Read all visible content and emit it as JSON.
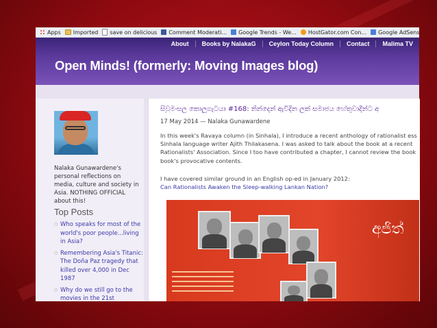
{
  "bookmarks": [
    {
      "label": "Apps",
      "icon": "apps-icon"
    },
    {
      "label": "Imported",
      "icon": "folder-icon"
    },
    {
      "label": "save on delicious",
      "icon": "page-icon"
    },
    {
      "label": "Comment Moderati...",
      "icon": "facebook-icon"
    },
    {
      "label": "Google Trends - We...",
      "icon": "google-icon"
    },
    {
      "label": "HostGator.com Con...",
      "icon": "hostgator-icon"
    },
    {
      "label": "Google AdSense",
      "icon": "google-icon"
    }
  ],
  "nav": [
    "About",
    "Books by NalakaG",
    "Ceylon Today Column",
    "Contact",
    "Malima TV"
  ],
  "site": {
    "title": "Open Minds! (formerly: Moving Images blog)"
  },
  "sidebar": {
    "bio": "Nalaka Gunawardene's personal reflections on media, culture and society in Asia. NOTHING OFFICIAL about this!",
    "top_posts_heading": "Top Posts",
    "posts": [
      "Who speaks for most of the world's poor people...living in Asia?",
      "Remembering Asia's Titanic: The Doña Paz tragedy that killed over 4,000 in Dec 1987",
      "Why do we still go to the movies in the 21st"
    ]
  },
  "post": {
    "title": "සිවුමංසල කොලුගැටයා #168: නින්දෙන් ඇවිදින ලක් සමාජය හේතුවාදීන්ට අ",
    "meta": "17 May 2014 — Nalaka Gunawardene",
    "para1": [
      "In this week's Ravaya column (in Sinhala), I introduce a recent anthology of rationalist ess",
      "Sinhala language writer Ajith Thilakasena. I was asked to talk about the book at a recent",
      "Rationalists' Association. Since I too have contributed a chapter, I cannot review the book",
      "book's provocative contents."
    ],
    "para2": "I have covered similar ground in an English op-ed in January 2012:",
    "link": "Can Rationalists Awaken the Sleep-walking Lankan Nation?",
    "book_cover_text": "අජිත්"
  },
  "colors": {
    "background": "#a50f16",
    "header": "#5b3a9c",
    "link": "#3a3aa8"
  }
}
